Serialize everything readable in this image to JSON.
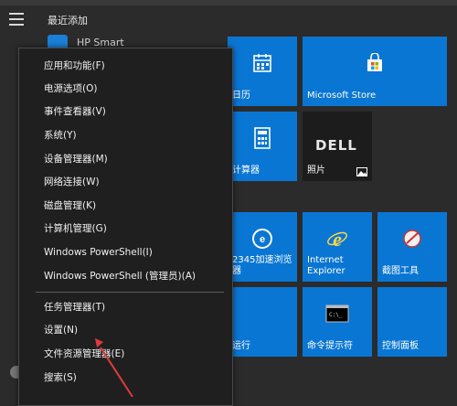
{
  "start": {
    "recent_label": "最近添加",
    "hp_label": "HP Smart"
  },
  "tiles": {
    "calendar": "日历",
    "store": "Microsoft Store",
    "calculator": "计算器",
    "photos": "照片",
    "dell": "DELL",
    "browser2345": "2345加速浏览器",
    "ie": "Internet\nExplorer",
    "snip": "截图工具",
    "run": "运行",
    "cmd": "命令提示符",
    "control": "控制面板"
  },
  "menu": {
    "items": [
      "应用和功能(F)",
      "电源选项(O)",
      "事件查看器(V)",
      "系统(Y)",
      "设备管理器(M)",
      "网络连接(W)",
      "磁盘管理(K)",
      "计算机管理(G)",
      "Windows PowerShell(I)",
      "Windows PowerShell (管理员)(A)",
      "任务管理器(T)",
      "设置(N)",
      "文件资源管理器(E)",
      "搜索(S)"
    ]
  },
  "colors": {
    "tile_blue": "#0a76d4",
    "menu_bg": "#1f1f1f",
    "arrow_red": "#e03b3b"
  }
}
